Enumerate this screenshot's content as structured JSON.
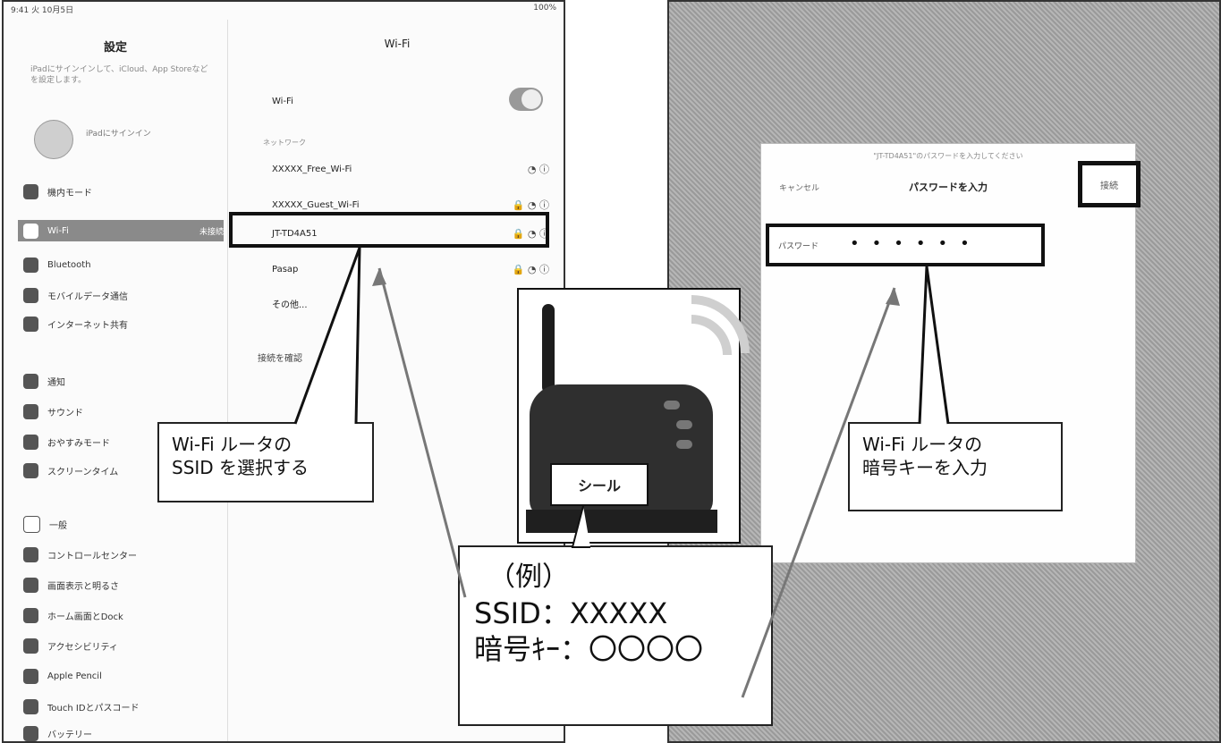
{
  "left": {
    "status_left": "9:41 火 10月5日",
    "status_right": "100%",
    "sidebar_title": "設定",
    "wifi_title": "Wi-Fi",
    "promo": "iPadにサインインして、iCloud、App Storeなどを設定します。",
    "apple_id": "iPadにサインイン",
    "sidebar": [
      {
        "label": "機内モード",
        "icon": "airplane-icon",
        "selected": false
      },
      {
        "label": "Wi-Fi",
        "icon": "wifi-icon",
        "selected": true,
        "badge": "未接続"
      },
      {
        "label": "Bluetooth",
        "icon": "bluetooth-icon",
        "selected": false
      },
      {
        "label": "モバイルデータ通信",
        "icon": "antenna-icon",
        "selected": false
      },
      {
        "label": "インターネット共有",
        "icon": "link-icon",
        "selected": false
      },
      {
        "label": "通知",
        "icon": "bell-icon",
        "selected": false
      },
      {
        "label": "サウンド",
        "icon": "speaker-icon",
        "selected": false
      },
      {
        "label": "おやすみモード",
        "icon": "moon-icon",
        "selected": false
      },
      {
        "label": "スクリーンタイム",
        "icon": "hourglass-icon",
        "selected": false
      },
      {
        "label": "一般",
        "icon": "gear-icon",
        "selected": false
      },
      {
        "label": "コントロールセンター",
        "icon": "switches-icon",
        "selected": false
      },
      {
        "label": "画面表示と明るさ",
        "icon": "aa-icon",
        "selected": false
      },
      {
        "label": "ホーム画面とDock",
        "icon": "grid-icon",
        "selected": false
      },
      {
        "label": "アクセシビリティ",
        "icon": "accessibility-icon",
        "selected": false
      },
      {
        "label": "Apple Pencil",
        "icon": "pencil-icon",
        "selected": false
      },
      {
        "label": "Touch IDとパスコード",
        "icon": "fingerprint-icon",
        "selected": false
      },
      {
        "label": "バッテリー",
        "icon": "battery-icon",
        "selected": false
      }
    ],
    "wifi_label": "Wi-Fi",
    "networks_header": "ネットワーク",
    "networks": [
      {
        "name": "XXXXX_Free_Wi-Fi",
        "lock": false
      },
      {
        "name": "XXXXX_Guest_Wi-Fi",
        "lock": true
      },
      {
        "name": "JT-TD4A51",
        "lock": true
      },
      {
        "name": "Pasap",
        "lock": true
      },
      {
        "name": "その他...",
        "lock": false
      }
    ],
    "ask_join_label": "接続を確認",
    "callout": [
      "Wi-Fi ルータの",
      "SSID を選択する"
    ]
  },
  "right": {
    "dialog_subtitle": "\"JT-TD4A51\"のパスワードを入力してください",
    "dialog_title": "パスワードを入力",
    "cancel": "キャンセル",
    "join": "接続",
    "password_label": "パスワード",
    "password_dots": "••••••",
    "callout": [
      "Wi-Fi ルータの",
      "暗号キーを入力"
    ]
  },
  "router": {
    "seal_label": "シール"
  },
  "example": {
    "head": "（例）",
    "ssid_line": "SSID：XXXXX",
    "key_line": "暗号ｷｰ：〇〇〇〇"
  }
}
